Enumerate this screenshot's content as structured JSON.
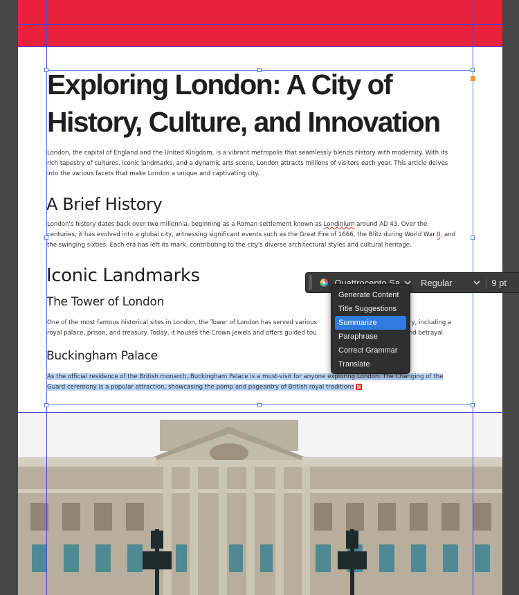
{
  "document": {
    "title": "Exploring London: A City of History, Culture, and Innovation",
    "title_line1": "Exploring London: A City of",
    "title_line2": "History, Culture, and Innovation",
    "intro": [
      "London, the capital of England and the United Kingdom, is a vibrant metropolis that seamlessly blends history with modernity. With its",
      "rich tapestry of cultures, iconic landmarks, and a dynamic arts scene, London attracts millions of visitors each year. This article delves",
      "into the various facets that make London a unique and captivating city."
    ],
    "sections": {
      "history_heading": "A Brief History",
      "history_lines": [
        "London's history dates back over two millennia, beginning as a Roman settlement known as ",
        "Londinium",
        " around AD 43. Over the",
        "centuries, it has evolved into a global city, witnessing significant events such as the Great Fire of 1666, the Blitz during World War ",
        "II",
        ", and",
        "the swinging sixties. Each era has left its mark, contributing to the city's diverse architectural styles and cultural heritage."
      ],
      "landmarks_heading": "Iconic Landmarks",
      "tower_heading": "The Tower of London",
      "tower_lines": [
        "One of the most famous historical sites in London, the Tower of London has served various",
        "history, including a",
        "royal palace, prison, and treasury. Today, it houses the Crown Jewels and offers guided tou",
        "rigue and betrayal."
      ],
      "palace_heading": "Buckingham Palace",
      "palace_lines": [
        "As the official residence of the British monarch, Buckingham Palace is a must-visit for anyone exploring London. The Changing of the",
        "Guard ceremony is a popular attraction, showcasing the pomp and pageantry of British royal traditions"
      ]
    }
  },
  "toolbar": {
    "font_family": "Quattrocento Sa",
    "font_style": "Regular",
    "font_size": "9 pt",
    "ai_icon": "ai-sparkle-icon"
  },
  "menu": {
    "items": [
      "Generate Content",
      "Title Suggestions",
      "Summarize",
      "Paraphrase",
      "Correct Grammar",
      "Translate"
    ],
    "active_index": 2
  },
  "colors": {
    "banner": "#e8213d",
    "selection": "#b9d3f6",
    "menu_active": "#2f7de1",
    "frame": "#4a7ee6"
  }
}
